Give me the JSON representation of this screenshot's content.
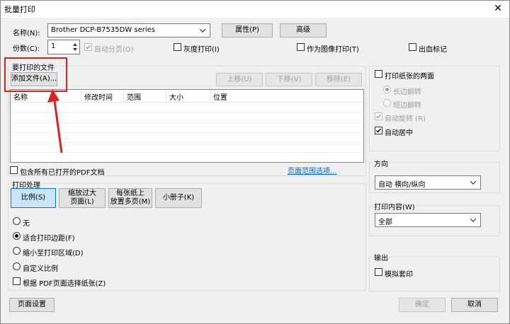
{
  "window": {
    "title": "批量打印"
  },
  "printer": {
    "name_label": "名称(N):",
    "name_value": "Brother DCP-B7535DW series",
    "properties_button": "属性(P)",
    "advanced_button": "高级",
    "copies_label": "份数(C):",
    "copies_value": "1",
    "collate": "自动分页(O)",
    "grayscale": "灰度打印(I)",
    "as_image": "作为图像打印(T)",
    "bleed": "出血标记"
  },
  "files": {
    "group_title": "要打印的文件",
    "add_button": "添加文件(A)...",
    "up_button": "上移(U)",
    "down_button": "下移(V)",
    "remove_button": "移除(E)",
    "columns": [
      "名称",
      "修改时间",
      "范围",
      "大小",
      "位置"
    ],
    "include_open": "包含所有已打开的PDF文档",
    "page_range_link": "页面范围选项..."
  },
  "handling": {
    "group_title": "打印处理",
    "tabs": [
      "比例(S)",
      "缩放过大\n页面(L)",
      "每张纸上\n放置多页(M)",
      "小册子(K)"
    ],
    "options": [
      "无",
      "适合打印边距(F)",
      "缩小至打印区域(D)",
      "自定义比例"
    ],
    "selected_option": "适合打印边距(F)",
    "choose_by_pdf": "根据 PDF页面选择纸张(Z)"
  },
  "duplex": {
    "both_sides": "打印纸张的两面",
    "long_edge": "长边翻转",
    "short_edge": "短边翻转",
    "auto_rotate": "自动旋转 (R)",
    "auto_center": "自动居中"
  },
  "orientation": {
    "group_title": "方向",
    "value": "自动 横向/纵向"
  },
  "content": {
    "group_title": "打印内容(W)",
    "value": "全部"
  },
  "output": {
    "group_title": "输出",
    "simulate": "模拟套印"
  },
  "footer": {
    "page_setup": "页面设置",
    "ok": "确定",
    "cancel": "取消"
  },
  "colors": {
    "accent": "#0078d7",
    "annotation": "#e02020"
  }
}
